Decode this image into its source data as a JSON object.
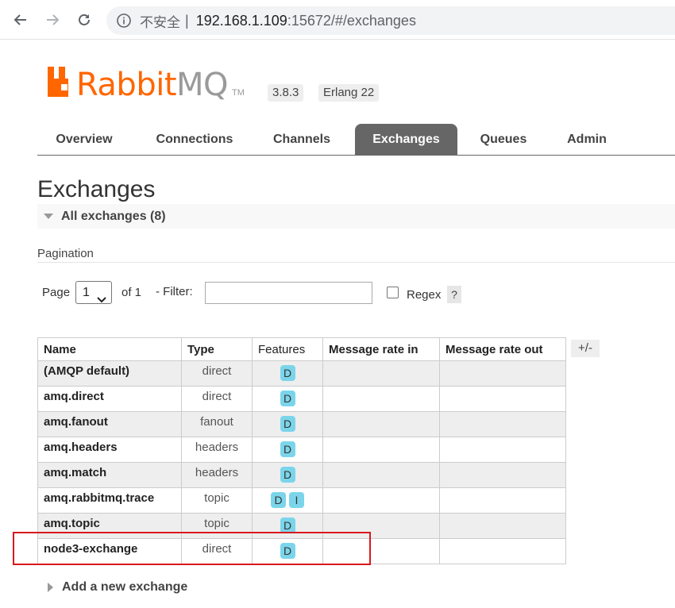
{
  "browser": {
    "security_label": "不安全",
    "separator": "|",
    "url_host": "192.168.1.109",
    "url_rest": ":15672/#/exchanges"
  },
  "logo": {
    "rabbit": "Rabbit",
    "mq": "MQ",
    "tm": "TM"
  },
  "versions": {
    "rabbitmq": "3.8.3",
    "erlang": "Erlang 22"
  },
  "tabs": [
    {
      "label": "Overview"
    },
    {
      "label": "Connections"
    },
    {
      "label": "Channels"
    },
    {
      "label": "Exchanges"
    },
    {
      "label": "Queues"
    },
    {
      "label": "Admin"
    }
  ],
  "page_title": "Exchanges",
  "section": {
    "label": "All exchanges (8)"
  },
  "pagination": {
    "label": "Pagination",
    "page_label": "Page",
    "page_value": "1",
    "of_label": "of 1",
    "filter_label": "- Filter:",
    "filter_value": "",
    "regex_label": "Regex",
    "help": "?"
  },
  "table": {
    "headers": {
      "name": "Name",
      "type": "Type",
      "features": "Features",
      "rate_in": "Message rate in",
      "rate_out": "Message rate out"
    },
    "toggle_columns": "+/-",
    "rows": [
      {
        "name": "(AMQP default)",
        "type": "direct",
        "features": [
          "D"
        ]
      },
      {
        "name": "amq.direct",
        "type": "direct",
        "features": [
          "D"
        ]
      },
      {
        "name": "amq.fanout",
        "type": "fanout",
        "features": [
          "D"
        ]
      },
      {
        "name": "amq.headers",
        "type": "headers",
        "features": [
          "D"
        ]
      },
      {
        "name": "amq.match",
        "type": "headers",
        "features": [
          "D"
        ]
      },
      {
        "name": "amq.rabbitmq.trace",
        "type": "topic",
        "features": [
          "D",
          "I"
        ]
      },
      {
        "name": "amq.topic",
        "type": "topic",
        "features": [
          "D"
        ]
      },
      {
        "name": "node3-exchange",
        "type": "direct",
        "features": [
          "D"
        ]
      }
    ]
  },
  "add_new": "Add a new exchange",
  "colors": {
    "brand_orange": "#ff6600",
    "feature_badge": "#7bd5ea",
    "active_tab": "#666666",
    "highlight_box": "#d9191c"
  }
}
